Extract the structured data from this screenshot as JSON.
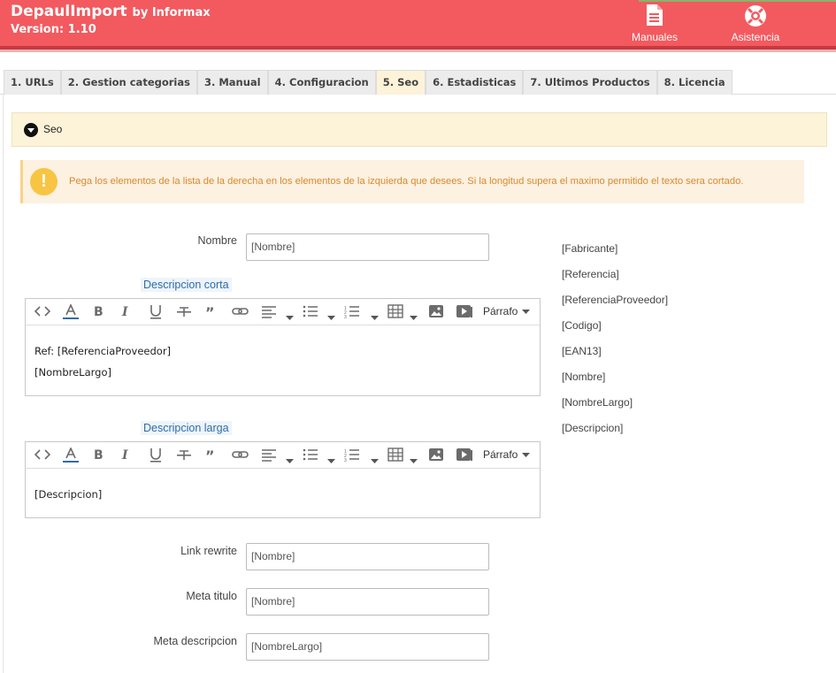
{
  "header": {
    "app_name": "DepaulImport",
    "by": "by Informax",
    "version": "Version: 1.10",
    "buttons": [
      {
        "label": "Manuales",
        "icon": "document-icon"
      },
      {
        "label": "Asistencia",
        "icon": "lifebuoy-icon"
      }
    ],
    "brand_color": "#f25a5f"
  },
  "tabs": [
    {
      "label": "1. URLs"
    },
    {
      "label": "2. Gestion categorias"
    },
    {
      "label": "3. Manual"
    },
    {
      "label": "4. Configuracion"
    },
    {
      "label": "5. Seo",
      "active": true
    },
    {
      "label": "6. Estadisticas"
    },
    {
      "label": "7. Ultimos Productos"
    },
    {
      "label": "8. Licencia"
    }
  ],
  "panel": {
    "title": "Seo",
    "alert": "Pega los elementos de la lista de la derecha en los elementos de la izquierda que desees. Si la longitud supera el maximo permitido el texto sera cortado."
  },
  "form": {
    "nombre": {
      "label": "Nombre",
      "value": "[Nombre]"
    },
    "desc_corta": {
      "label": "Descripcion corta",
      "lines": [
        "Ref: [ReferenciaProveedor]",
        "[NombreLargo]"
      ]
    },
    "desc_larga": {
      "label": "Descripcion larga",
      "lines": [
        "[Descripcion]"
      ]
    },
    "link_rewrite": {
      "label": "Link rewrite",
      "value": "[Nombre]"
    },
    "meta_titulo": {
      "label": "Meta titulo",
      "value": "[Nombre]"
    },
    "meta_descripcion": {
      "label": "Meta descripcion",
      "value": "[NombreLargo]"
    }
  },
  "editor_toolbar": {
    "paragraph": "Párrafo"
  },
  "placeholders": [
    "[Fabricante]",
    "[Referencia]",
    "[ReferenciaProveedor]",
    "[Codigo]",
    "[EAN13]",
    "[Nombre]",
    "[NombreLargo]",
    "[Descripcion]"
  ]
}
